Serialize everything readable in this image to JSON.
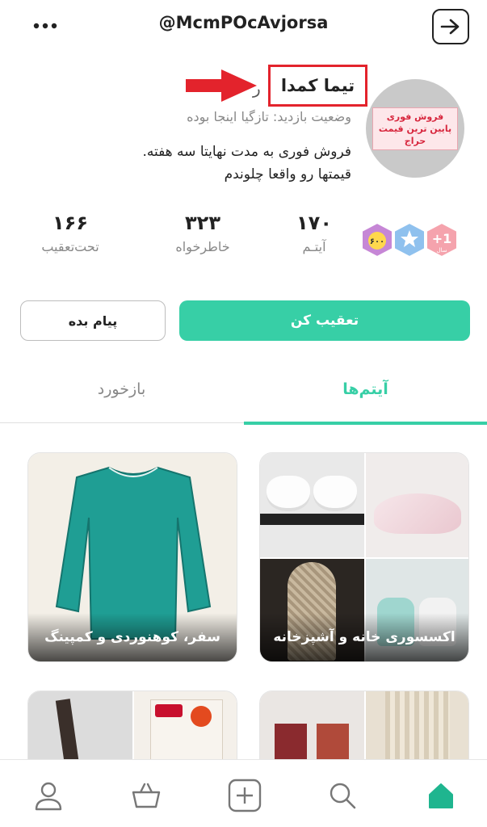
{
  "header": {
    "username": "@McmPOcAvjorsa",
    "more_icon": "more-dots-icon",
    "back_icon": "arrow-right-box-icon"
  },
  "profile": {
    "display_name": "تیما کمدا",
    "visit_status": "وضعیت بازدید: تازگیا اینجا بوده",
    "bio_line1": "فروش فوری به مدت نهایتا سه هفته.",
    "bio_line2": "قیمتها رو واقعا چلوندم",
    "avatar_text1": "فروش فوری",
    "avatar_text2": "پایین ترین قیمت",
    "avatar_text3": "حراج",
    "badges": [
      "one-year-badge-icon",
      "star-badge-icon",
      "600-badge-icon"
    ],
    "badge_one_year": "+1",
    "badge_one_year_sub": "سال",
    "badge_600": "۶۰۰"
  },
  "stats": {
    "items_value": "۱۷۰",
    "items_label": "آیتـم",
    "favorites_value": "۳۲۳",
    "favorites_label": "خاطرخواه",
    "following_value": "۱۶۶",
    "following_label": "تحت‌تعقیب"
  },
  "actions": {
    "follow_label": "تعقیب کن",
    "message_label": "پیام بده"
  },
  "tabs": {
    "items": "آیتم‌ها",
    "reviews": "بازخورد"
  },
  "categories": {
    "home_kitchen": "اکسسوری خانه و آشپزخانه",
    "travel_camping": "سفر، کوهنوردی و کمپینگ"
  },
  "colors": {
    "accent": "#37cfa6",
    "highlight_box": "#e3232c",
    "avatar_bg": "#c9c9c9"
  },
  "bottom_nav": [
    "home-icon",
    "search-icon",
    "add-icon",
    "basket-icon",
    "profile-icon"
  ]
}
